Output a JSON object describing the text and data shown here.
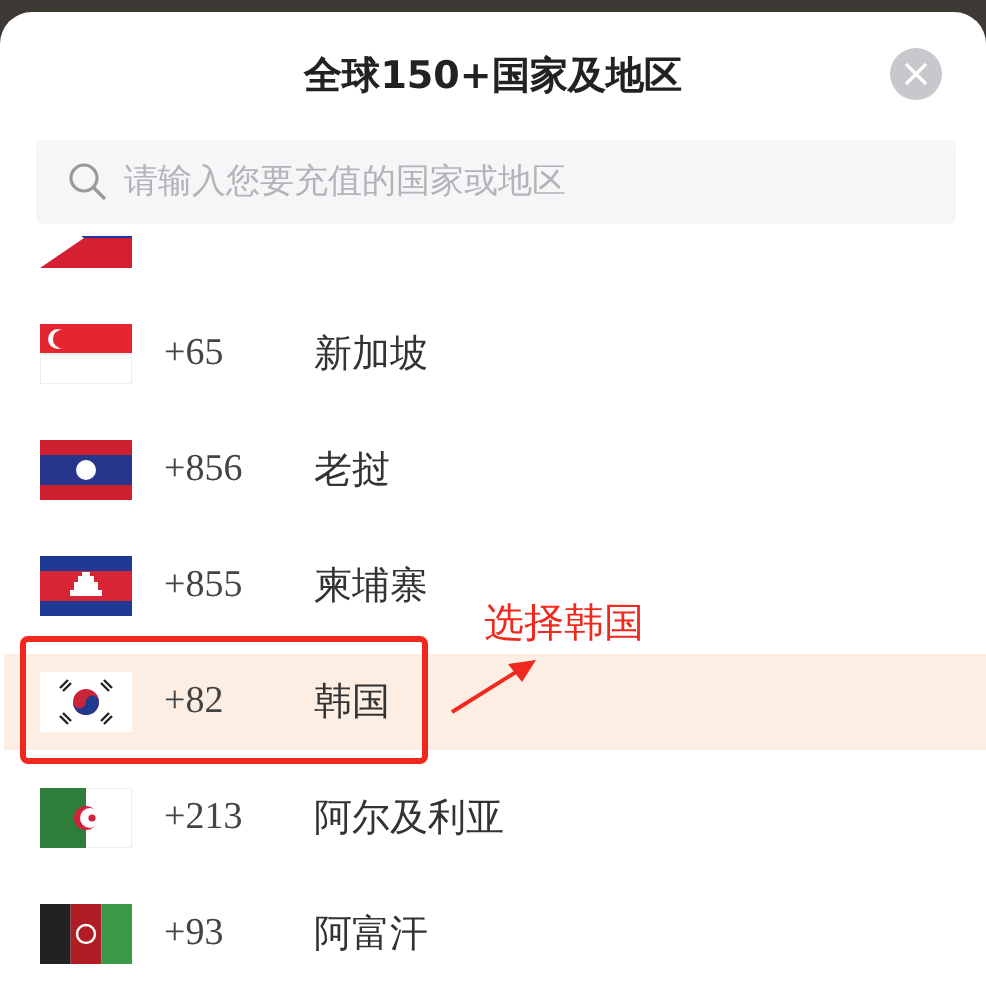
{
  "title": "全球150+国家及地区",
  "search": {
    "placeholder": "请输入您要充值的国家或地区"
  },
  "countries": [
    {
      "kind": "philippines",
      "selected": false
    },
    {
      "kind": "singapore",
      "code": "+65",
      "name": "新加坡",
      "selected": false
    },
    {
      "kind": "laos",
      "code": "+856",
      "name": "老挝",
      "selected": false
    },
    {
      "kind": "cambodia",
      "code": "+855",
      "name": "柬埔寨",
      "selected": false
    },
    {
      "kind": "korea",
      "code": "+82",
      "name": "韩国",
      "selected": true
    },
    {
      "kind": "algeria",
      "code": "+213",
      "name": "阿尔及利亚",
      "selected": false
    },
    {
      "kind": "afghanistan",
      "code": "+93",
      "name": "阿富汗",
      "selected": false
    }
  ],
  "annotation": {
    "text": "选择韩国"
  }
}
